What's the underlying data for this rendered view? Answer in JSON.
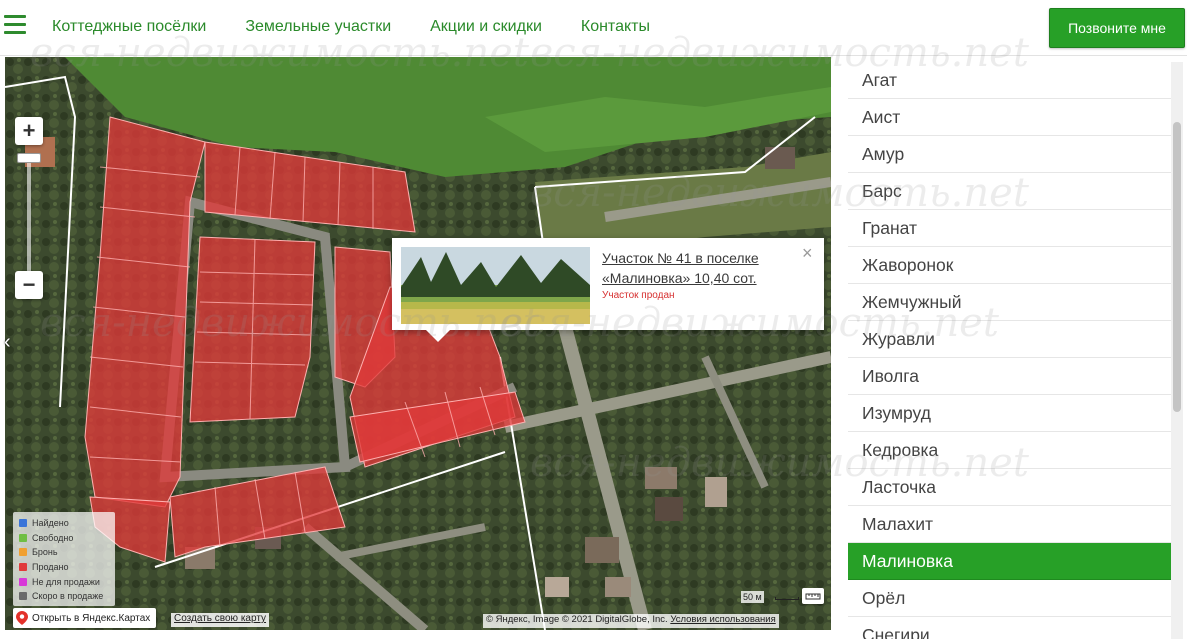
{
  "header": {
    "nav": [
      "Коттеджные посёлки",
      "Земельные участки",
      "Акции и скидки",
      "Контакты"
    ],
    "call_label": "Позвоните мне"
  },
  "map": {
    "zoom_in": "+",
    "zoom_out": "−",
    "popup": {
      "title": "Участок № 41 в поселке «Малиновка» 10,40 сот.",
      "status": "Участок продан",
      "close": "×"
    },
    "legend": [
      {
        "label": "Найдено",
        "color": "#3a74d8"
      },
      {
        "label": "Свободно",
        "color": "#6fbe44"
      },
      {
        "label": "Бронь",
        "color": "#f0a030"
      },
      {
        "label": "Продано",
        "color": "#e03a3a"
      },
      {
        "label": "Не для продажи",
        "color": "#d838d8"
      },
      {
        "label": "Скоро в продаже",
        "color": "#6a6a6a"
      }
    ],
    "open_yandex": "Открыть в Яндекс.Картах",
    "create_map": "Создать свою карту",
    "copyright": "© Яндекс, Image © 2021 DigitalGlobe, Inc.",
    "terms": "Условия использования",
    "scale": "50 м"
  },
  "villages": {
    "items": [
      "Агат",
      "Аист",
      "Амур",
      "Барс",
      "Гранат",
      "Жаворонок",
      "Жемчужный",
      "Журавли",
      "Иволга",
      "Изумруд",
      "Кедровка",
      "Ласточка",
      "Малахит",
      "Малиновка",
      "Орёл",
      "Снегири"
    ],
    "selected": "Малиновка"
  },
  "watermark": "вся-недвижимость.net",
  "colors": {
    "accent": "#27a027",
    "sold": "#e03a3a"
  }
}
